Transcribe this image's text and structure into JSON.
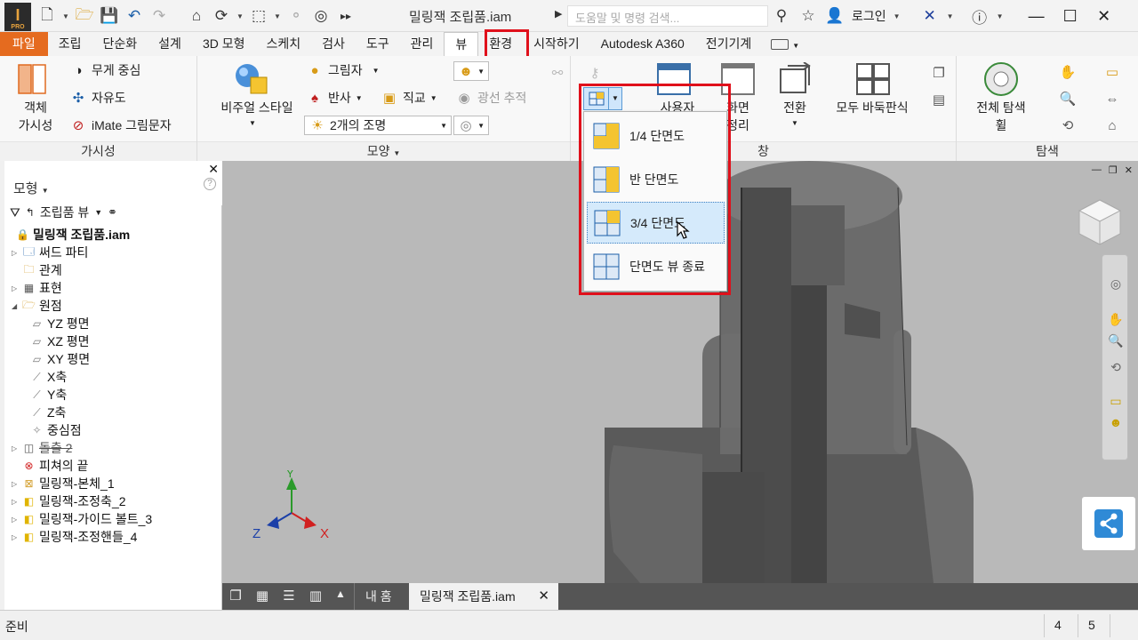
{
  "app": {
    "logo_text": "I",
    "logo_sub": "PRO",
    "title": "밀링잭 조립품.iam",
    "search_placeholder": "도움말 및 명령 검색...",
    "login": "로그인"
  },
  "ribbon_tabs": [
    "파일",
    "조립",
    "단순화",
    "설계",
    "3D 모형",
    "스케치",
    "검사",
    "도구",
    "관리",
    "뷰",
    "환경",
    "시작하기",
    "Autodesk A360",
    "전기기계"
  ],
  "ribbon": {
    "visibility": {
      "object_visibility": "객체\n가시성",
      "center_of_gravity": "무게 중심",
      "degrees_of_freedom": "자유도",
      "imate_glyph": "iMate 그림문자",
      "label": "가시성"
    },
    "appearance": {
      "visual_style": "비주얼 스타일",
      "shadows": "그림자",
      "reflections": "반사",
      "orthographic": "직교",
      "ray_tracing": "광선 추적",
      "lighting": "2개의 조명",
      "label": "모양"
    },
    "windows": {
      "user_interface": "사용자",
      "clean_screen": "화면\n정리",
      "switch": "전환",
      "arrange_all": "모두 바둑판식",
      "label": "창"
    },
    "navigate": {
      "full_nav_wheel": "전체 탐색\n휠",
      "label": "탐색"
    }
  },
  "section_menu": {
    "items": [
      "1/4 단면도",
      "반 단면도",
      "3/4 단면도",
      "단면도 뷰 종료"
    ],
    "hovered_index": 2
  },
  "browser": {
    "title": "모형",
    "filter_label": "조립품 뷰",
    "tree": [
      {
        "label": "밀링잭 조립품.iam",
        "bold": true
      },
      {
        "label": "써드 파티"
      },
      {
        "label": "관계"
      },
      {
        "label": "표현"
      },
      {
        "label": "원점"
      },
      {
        "label": "YZ 평면"
      },
      {
        "label": "XZ 평면"
      },
      {
        "label": "XY 평면"
      },
      {
        "label": "X축"
      },
      {
        "label": "Y축"
      },
      {
        "label": "Z축"
      },
      {
        "label": "중심점"
      },
      {
        "label": "돌출 2",
        "struck": true
      },
      {
        "label": "피쳐의 끝"
      },
      {
        "label": "밀링잭-본체_1"
      },
      {
        "label": "밀링잭-조정축_2"
      },
      {
        "label": "밀링잭-가이드 볼트_3"
      },
      {
        "label": "밀링잭-조정핸들_4"
      }
    ]
  },
  "axes": {
    "x": "X",
    "y": "Y",
    "z": "Z"
  },
  "doc_tabs": {
    "home": "내 홈",
    "active": "밀링잭 조립품.iam"
  },
  "status": {
    "text": "준비",
    "num1": "4",
    "num2": "5"
  },
  "colors": {
    "file_tab": "#e56b1f",
    "highlight_red": "#e0101b",
    "viewport_bg": "#b9b9b9"
  }
}
